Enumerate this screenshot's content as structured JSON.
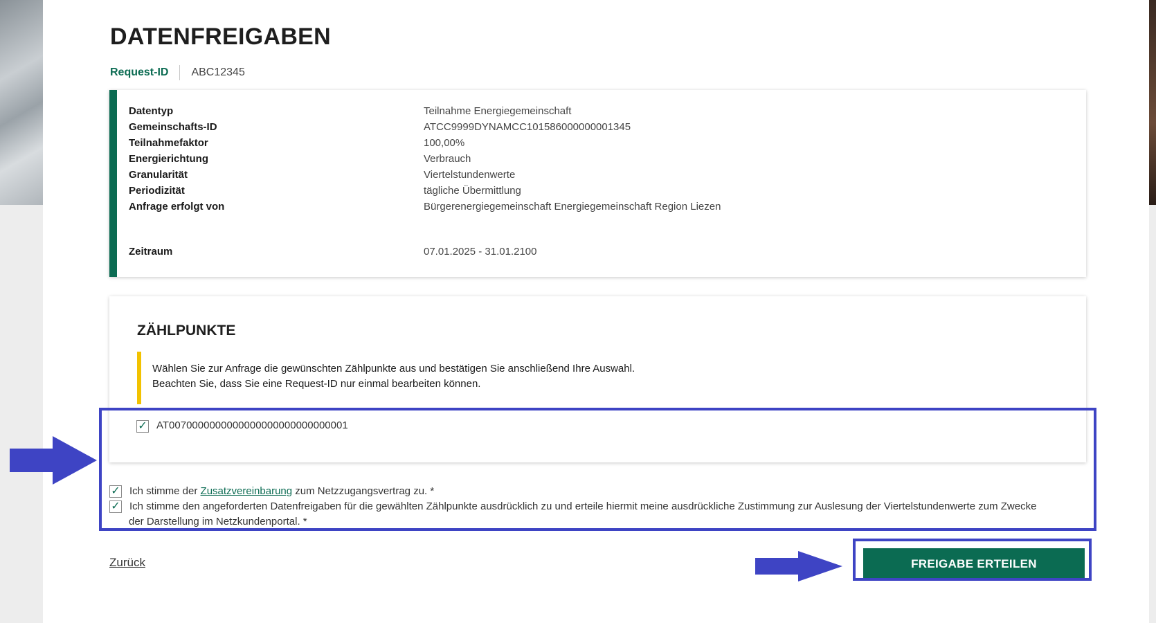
{
  "page": {
    "title": "DATENFREIGABEN"
  },
  "request": {
    "label": "Request-ID",
    "value": "ABC12345"
  },
  "details": [
    {
      "label": "Datentyp",
      "value": "Teilnahme Energiegemeinschaft"
    },
    {
      "label": "Gemeinschafts-ID",
      "value": "ATCC9999DYNAMCC101586000000001345"
    },
    {
      "label": "Teilnahmefaktor",
      "value": "100,00%"
    },
    {
      "label": "Energierichtung",
      "value": "Verbrauch"
    },
    {
      "label": "Granularität",
      "value": "Viertelstundenwerte"
    },
    {
      "label": "Periodizität",
      "value": "tägliche Übermittlung"
    },
    {
      "label": "Anfrage erfolgt von",
      "value": "Bürgerenergiegemeinschaft Energiegemeinschaft Region Liezen"
    },
    {
      "label": "Zeitraum",
      "value": "07.01.2025 - 31.01.2100"
    }
  ],
  "zaehlpunkte": {
    "title": "ZÄHLPUNKTE",
    "notice_line1": "Wählen Sie zur Anfrage die gewünschten Zählpunkte aus und bestätigen Sie anschließend Ihre Auswahl.",
    "notice_line2": "Beachten Sie, dass Sie eine Request-ID nur einmal bearbeiten können.",
    "meteringpoint": {
      "id": "AT0070000000000000000000000000001",
      "checked": true
    }
  },
  "consent": {
    "c1": {
      "checked": true,
      "before": "Ich stimme der ",
      "link": "Zusatzvereinbarung",
      "after": " zum Netzzugangsvertrag zu. *"
    },
    "c2": {
      "checked": true,
      "line1": "Ich stimme den angeforderten Datenfreigaben für die gewählten Zählpunkte ausdrücklich zu und erteile hiermit meine ausdrückliche Zustimmung zur Auslesung der Viertelstundenwerte zum Zwecke",
      "line2": "der Darstellung im Netzkundenportal. *"
    }
  },
  "actions": {
    "back": "Zurück",
    "submit": "FREIGABE ERTEILEN"
  },
  "colors": {
    "brand": "#0b6b52",
    "notice": "#f2c200",
    "highlight": "#3e44c4"
  },
  "icons": {
    "checkbox": "check-icon",
    "annotation": "arrow-right-icon"
  }
}
